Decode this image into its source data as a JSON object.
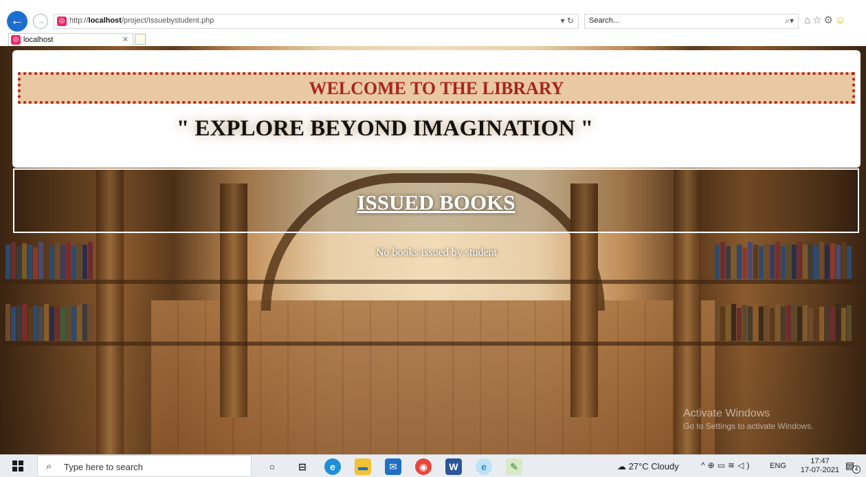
{
  "browser": {
    "url_prefix": "http://",
    "url_host": "localhost",
    "url_path": "/project/Issuebystudent.php",
    "search_placeholder": "Search...",
    "tab_title": "localhost",
    "refresh_label": "▾ ↻"
  },
  "page": {
    "welcome": "WELCOME TO THE LIBRARY",
    "tagline": "\" EXPLORE BEYOND IMAGINATION \"",
    "section_title": "ISSUED BOOKS",
    "empty_message": "No books issued by student"
  },
  "watermark": {
    "line1": "Activate Windows",
    "line2": "Go to Settings to activate Windows."
  },
  "taskbar": {
    "search_placeholder": "Type here to search",
    "weather": "27°C  Cloudy",
    "language": "ENG",
    "time": "17:47",
    "date": "17-07-2021",
    "notification_count": "4"
  },
  "colors": {
    "welcome_bg": "#e9c9a2",
    "welcome_text": "#a82424",
    "dotted_border": "#b22222",
    "browser_back": "#1c6fd1"
  }
}
